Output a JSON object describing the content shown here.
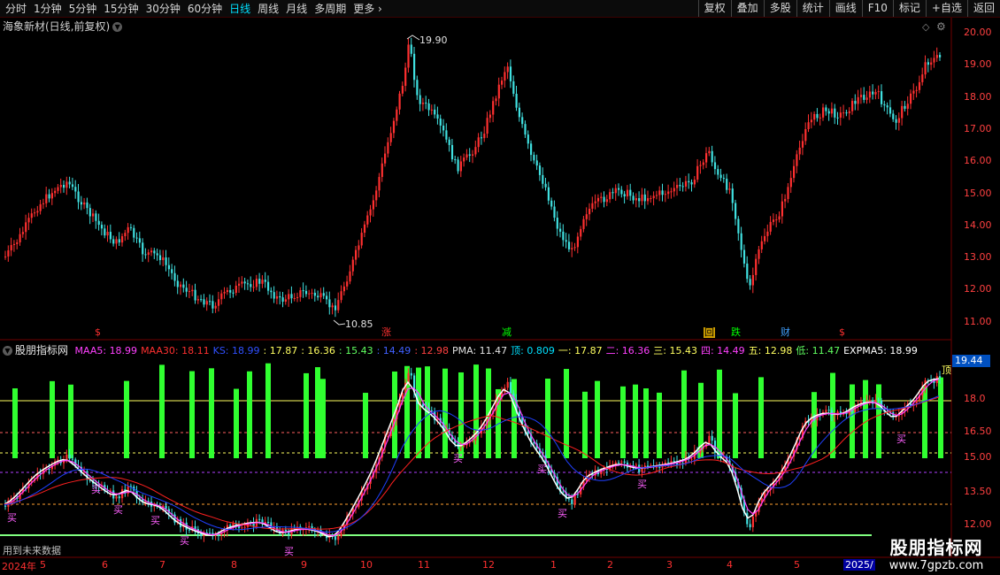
{
  "toolbar": {
    "periods": [
      "分时",
      "1分钟",
      "5分钟",
      "15分钟",
      "30分钟",
      "60分钟",
      "日线",
      "周线",
      "月线",
      "多周期",
      "更多 ›"
    ],
    "active_index": 6,
    "actions": [
      "复权",
      "叠加",
      "多股",
      "统计",
      "画线",
      "F10",
      "标记",
      "+自选",
      "返回"
    ]
  },
  "stock": {
    "title": "海象新材(日线,前复权)"
  },
  "price_chart": {
    "high_label": "19.90",
    "low_label": "10.85",
    "axis_ticks": [
      "20.00",
      "19.00",
      "18.00",
      "17.00",
      "16.00",
      "15.00",
      "14.00",
      "13.00",
      "12.00",
      "11.00"
    ],
    "markers": [
      {
        "label": "$",
        "color": "#ff3030"
      },
      {
        "label": "涨",
        "color": "#ff3030"
      },
      {
        "label": "减",
        "color": "#00ff00"
      },
      {
        "label": "回",
        "color": "#ffff00"
      },
      {
        "label": "跌",
        "color": "#00ff00"
      },
      {
        "label": "财",
        "color": "#40a0ff"
      },
      {
        "label": "$",
        "color": "#ff3030"
      }
    ]
  },
  "indicator": {
    "name": "股朋指标网",
    "values": [
      {
        "text": "MAA5: 18.99",
        "color": "#ff40ff"
      },
      {
        "text": "MAA30: 18.11",
        "color": "#ff3030"
      },
      {
        "text": "KS: 18.99",
        "color": "#3050ff"
      },
      {
        "text": ": 17.87",
        "color": "#ffff60"
      },
      {
        "text": ": 16.36",
        "color": "#ffff60"
      },
      {
        "text": ": 15.43",
        "color": "#60ff60"
      },
      {
        "text": ": 14.49",
        "color": "#4060ff"
      },
      {
        "text": ": 12.98",
        "color": "#ff4040"
      },
      {
        "text": "PMA: 11.47",
        "color": "#e0e0e0"
      },
      {
        "text": "顶: 0.809",
        "color": "#00e0ff"
      },
      {
        "text": "一: 17.87",
        "color": "#ffff60"
      },
      {
        "text": "二: 16.36",
        "color": "#ff40ff"
      },
      {
        "text": "三: 15.43",
        "color": "#ffff60"
      },
      {
        "text": "四: 14.49",
        "color": "#ff40ff"
      },
      {
        "text": "五: 12.98",
        "color": "#ffff60"
      },
      {
        "text": "低: 11.47",
        "color": "#60ff60"
      },
      {
        "text": "EXPMA5: 18.99",
        "color": "#ffffff"
      }
    ],
    "current_value": "19.44",
    "axis_ticks": [
      "18.0",
      "16.50",
      "15.00",
      "13.50",
      "12.00"
    ],
    "buy_label": "买",
    "top_label": "顶",
    "footer_note": "用到未来数据"
  },
  "dates": [
    "2024年",
    "5",
    "6",
    "7",
    "8",
    "9",
    "10",
    "11",
    "12",
    "1",
    "2",
    "3",
    "4",
    "5",
    "2025/"
  ],
  "watermark": {
    "name": "股朋指标网",
    "url": "www.7gpzb.com"
  }
}
